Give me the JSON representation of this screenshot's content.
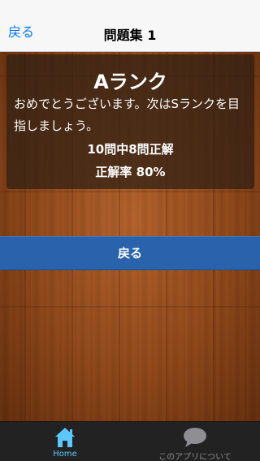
{
  "navbar": {
    "back_label": "戻る",
    "title": "問題集 1"
  },
  "result": {
    "rank": "Aランク",
    "message": "おめでとうございます。次はSランクを目指しましょう。",
    "score": "10問中8問正解",
    "rate": "正解率 80%"
  },
  "back_button": {
    "label": "戻る"
  },
  "tabbar": {
    "tabs": [
      {
        "label": "Home",
        "icon": "home-icon",
        "active": true
      },
      {
        "label": "このアプリについて",
        "icon": "speech-bubble-icon",
        "active": false
      }
    ]
  },
  "colors": {
    "accent": "#007aff",
    "button": "#2a63ab",
    "tab_active": "#5ac8fa",
    "tab_inactive": "#8e8e93"
  }
}
